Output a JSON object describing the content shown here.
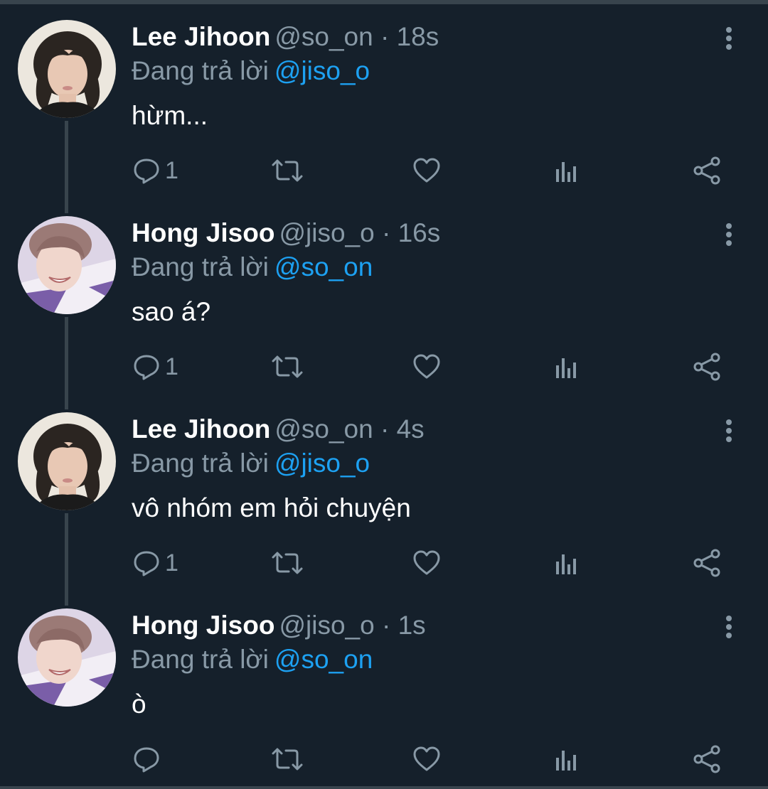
{
  "tweets": [
    {
      "name": "Lee Jihoon",
      "handle": "@so_on",
      "time": "18s",
      "reply_prefix": "Đang trả lời",
      "reply_to": "@jiso_o",
      "text": "hừm...",
      "reply_count": "1",
      "avatar": "avatar-lee-jihoon"
    },
    {
      "name": "Hong Jisoo",
      "handle": "@jiso_o",
      "time": "16s",
      "reply_prefix": "Đang trả lời",
      "reply_to": "@so_on",
      "text": "sao á?",
      "reply_count": "1",
      "avatar": "avatar-hong-jisoo"
    },
    {
      "name": "Lee Jihoon",
      "handle": "@so_on",
      "time": "4s",
      "reply_prefix": "Đang trả lời",
      "reply_to": "@jiso_o",
      "text": "vô nhóm em hỏi chuyện",
      "reply_count": "1",
      "avatar": "avatar-lee-jihoon"
    },
    {
      "name": "Hong Jisoo",
      "handle": "@jiso_o",
      "time": "1s",
      "reply_prefix": "Đang trả lời",
      "reply_to": "@so_on",
      "text": "ò",
      "reply_count": "",
      "avatar": "avatar-hong-jisoo"
    }
  ],
  "icons": {
    "reply": "reply-icon",
    "retweet": "retweet-icon",
    "like": "heart-icon",
    "analytics": "analytics-icon",
    "share": "share-icon",
    "more": "more-vertical-icon"
  },
  "colors": {
    "background": "#15202b",
    "secondary_text": "#8899a6",
    "mention": "#1da1f2",
    "divider": "#38444d"
  }
}
